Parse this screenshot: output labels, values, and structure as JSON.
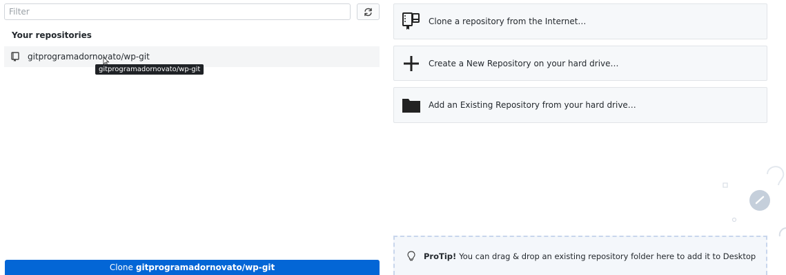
{
  "filter": {
    "placeholder": "Filter",
    "value": ""
  },
  "repositories": {
    "section_title": "Your repositories",
    "items": [
      {
        "name": "gitprogramadornovato/wp-git"
      }
    ],
    "tooltip": "gitprogramadornovato/wp-git"
  },
  "clone_button": {
    "prefix": "Clone",
    "repo": "gitprogramadornovato/wp-git"
  },
  "actions": [
    {
      "label": "Clone a repository from the Internet…",
      "icon": "clone-repo-icon"
    },
    {
      "label": "Create a New Repository on your hard drive…",
      "icon": "plus-icon"
    },
    {
      "label": "Add an Existing Repository from your hard drive…",
      "icon": "folder-icon"
    }
  ],
  "protip": {
    "title": "ProTip!",
    "text": "You can drag & drop an existing repository folder here to add it to Desktop",
    "icon": "lightbulb-icon"
  },
  "colors": {
    "primary": "#0366d6",
    "panel_bg": "#f6f8fa",
    "border": "#e1e4e8"
  }
}
